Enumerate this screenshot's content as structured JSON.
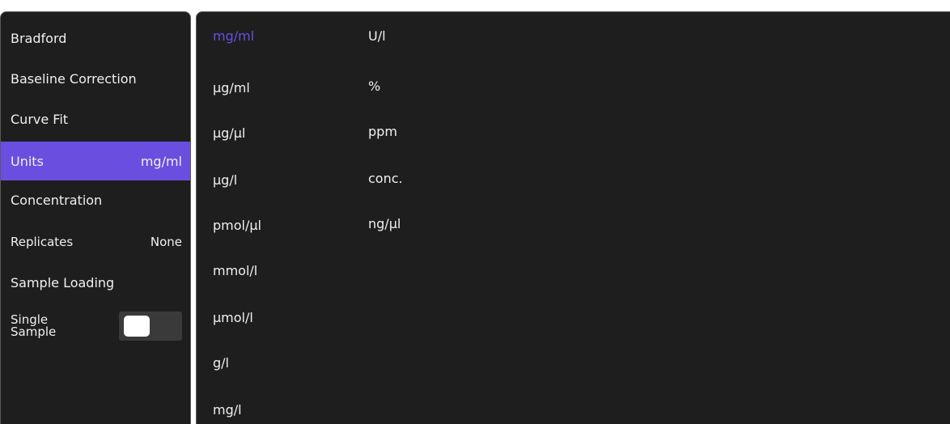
{
  "settings_menu": {
    "items": [
      {
        "label": "Bradford",
        "value": ""
      },
      {
        "label": "Baseline Correction",
        "value": ""
      },
      {
        "label": "Curve Fit",
        "value": ""
      },
      {
        "label": "Units",
        "value": "mg/ml"
      },
      {
        "label": "Concentration",
        "value": ""
      },
      {
        "label": "Replicates",
        "value": "None"
      },
      {
        "label": "Sample Loading",
        "value": ""
      }
    ],
    "single_sample": {
      "label_line1": "Single",
      "label_line2": "Sample",
      "toggle_state": "off"
    },
    "selected_item": "Units"
  },
  "units_picker": {
    "selected": "mg/ml",
    "column1": [
      "mg/ml",
      "µg/ml",
      "µg/µl",
      "µg/l",
      "pmol/µl",
      "mmol/l",
      "µmol/l",
      "g/l",
      "mg/l"
    ],
    "column2": [
      "U/l",
      "%",
      "ppm",
      "conc.",
      "ng/µl"
    ]
  },
  "colors": {
    "accent": "#6a4ee0",
    "panel_background": "#1e1e1e",
    "text": "#f0f0f0"
  }
}
